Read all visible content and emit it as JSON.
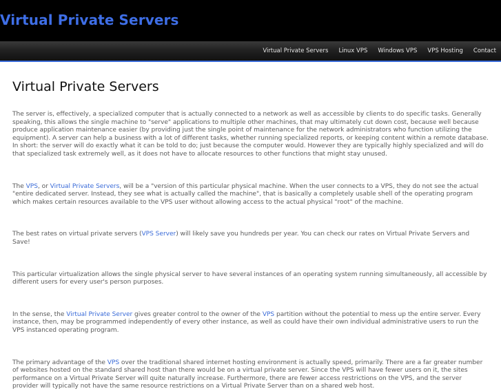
{
  "header": {
    "site_title": "Virtual Private Servers",
    "accent_color": "#3e6ee6"
  },
  "nav": {
    "items": [
      {
        "label": "Virtual Private Servers"
      },
      {
        "label": "Linux VPS"
      },
      {
        "label": "Windows VPS"
      },
      {
        "label": "VPS Hosting"
      },
      {
        "label": "Contact"
      }
    ]
  },
  "main": {
    "title": "Virtual Private Servers",
    "p1": "The server is, effectively, a specialized computer that is actually connected to a network as well as accessible by clients to do specific tasks. Generally speaking, this allows the single machine to \"serve\" applications to multiple other machines, that may ultimately cut down cost, because well because produce application maintenance easier (by providing just the single point of maintenance for the network administrators who function utilizing the equipment). A server can help a business with a lot of different tasks, whether running specialized reports, or keeping content within a remote database. In short: the server will do exactly what it can be told to do; just because the computer would. However they are typically highly specialized and will do that specialized task extremely well, as it does not have to allocate resources to other functions that might stay unused.",
    "p2": {
      "t1": "The ",
      "link1": "VPS",
      "t2": ", or ",
      "link2": "Virtual Private Servers",
      "t3": ", will be a \"version of this particular physical machine. When the user connects to a VPS, they do not see the actual \"entire dedicated server. Instead, they see what is actually called the machine\", that is basically a completely usable shell of the operating program which makes certain resources available to the VPS user without allowing access to the actual physical \"root\" of the machine."
    },
    "p3": {
      "t1": "The best rates on virtual private servers (",
      "link1": "VPS Server",
      "t2": ") will likely save you hundreds per year. You can check our rates on Virtual Private Servers and Save!"
    },
    "p4": "This particular virtualization allows the single physical server to have several instances of an operating system running simultaneously, all accessible by different users for every user's person purposes.",
    "p5": {
      "t1": "In the sense, the ",
      "link1": "Virtual Private Server",
      "t2": " gives greater control to the owner of the ",
      "link2": "VPS",
      "t3": " partition without the potential to mess up the entire server. Every instance, then, may be programmed independently of every other instance, as well as could have their own individual administrative users to run the VPS instanced operating program."
    },
    "p6": {
      "t1": "The primary advantage of the ",
      "link1": "VPS",
      "t2": " over the traditional shared internet hosting environment is actually speed, primarily. There are a far greater number of websites hosted on the standard shared host than there would be on a virtual private server. Since the VPS will have fewer users on it, the sites performance on a Virtual Private Server will quite naturally increase. Furthermore, there are fewer access restrictions on the VPS, and the server provider will typically not have the same resource restrictions on a Virtual Private Server than on a shared web host."
    }
  }
}
